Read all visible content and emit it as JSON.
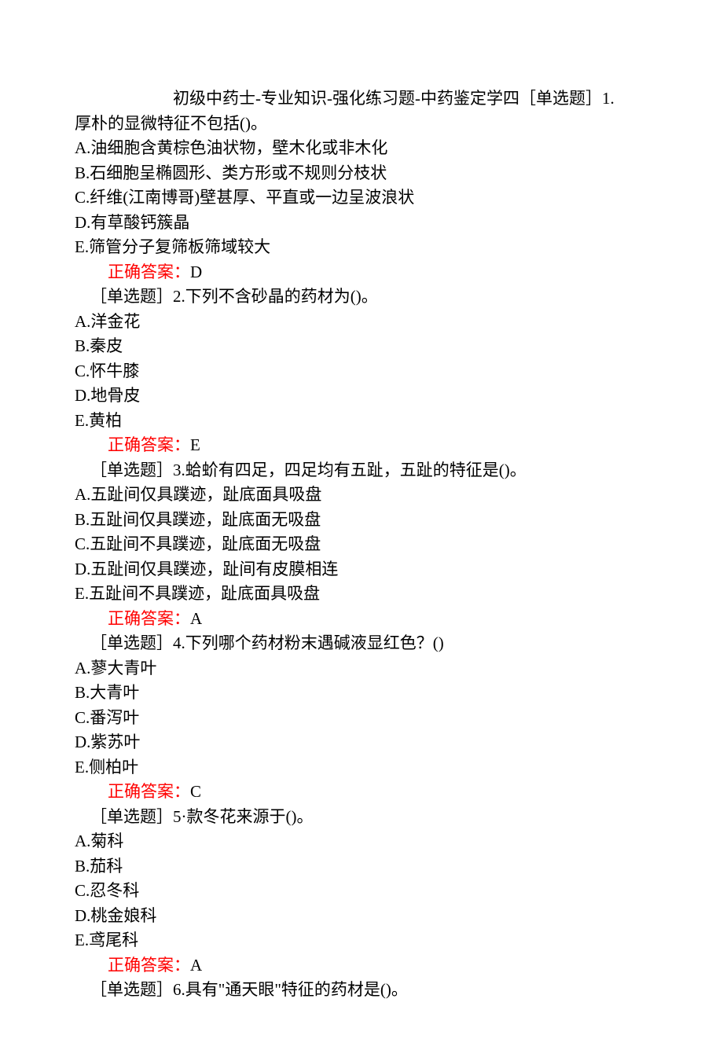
{
  "page_title": "初级中药士-专业知识-强化练习题-中药鉴定学四",
  "answer_label": "正确答案：",
  "question_type_label": "［单选题］",
  "questions": [
    {
      "number": "1.",
      "text": "厚朴的显微特征不包括()。",
      "options": [
        "A.油细胞含黄棕色油状物，壁木化或非木化",
        "B.石细胞呈椭圆形、类方形或不规则分枝状",
        "C.纤维(江南博哥)壁甚厚、平直或一边呈波浪状",
        "D.有草酸钙簇晶",
        "E.筛管分子复筛板筛域较大"
      ],
      "answer": "D"
    },
    {
      "number": "2.",
      "text": "下列不含砂晶的药材为()。",
      "options": [
        "A.洋金花",
        "B.秦皮",
        "C.怀牛膝",
        "D.地骨皮",
        "E.黄柏"
      ],
      "answer": "E"
    },
    {
      "number": "3.",
      "text": "蛤蚧有四足，四足均有五趾，五趾的特征是()。",
      "options": [
        "A.五趾间仅具蹼迹，趾底面具吸盘",
        "B.五趾间仅具蹼迹，趾底面无吸盘",
        "C.五趾间不具蹼迹，趾底面无吸盘",
        "D.五趾间仅具蹼迹，趾间有皮膜相连",
        "E.五趾间不具蹼迹，趾底面具吸盘"
      ],
      "answer": "A"
    },
    {
      "number": "4.",
      "text": "下列哪个药材粉末遇碱液显红色？()",
      "options": [
        "A.蓼大青叶",
        "B.大青叶",
        "C.番泻叶",
        "D.紫苏叶",
        "E.侧柏叶"
      ],
      "answer": "C"
    },
    {
      "number": "5·",
      "text": "款冬花来源于()。",
      "options": [
        "A.菊科",
        "B.茄科",
        "C.忍冬科",
        "D.桃金娘科",
        "E.鸢尾科"
      ],
      "answer": "A"
    },
    {
      "number": "6.",
      "text": "具有\"通天眼\"特征的药材是()。",
      "options": [],
      "answer": null
    }
  ]
}
